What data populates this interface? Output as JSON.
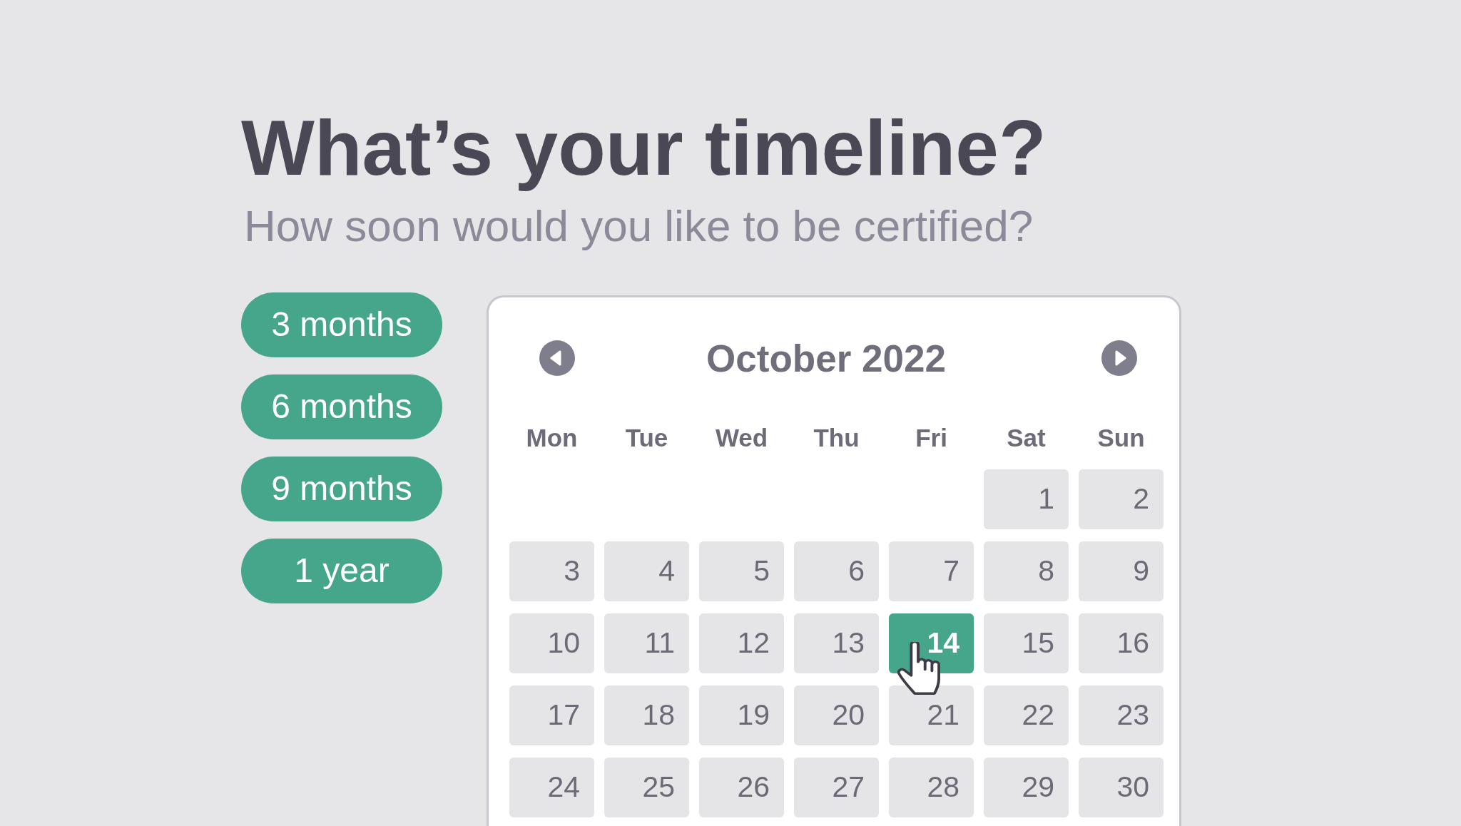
{
  "heading": "What’s your timeline?",
  "subheading": "How soon would you like to be certified?",
  "duration_options": [
    "3 months",
    "6 months",
    "9 months",
    "1 year"
  ],
  "calendar": {
    "title": "October 2022",
    "weekdays": [
      "Mon",
      "Tue",
      "Wed",
      "Thu",
      "Fri",
      "Sat",
      "Sun"
    ],
    "weeks": [
      {
        "days": [
          {
            "label": "1",
            "selected": false
          },
          {
            "label": "2",
            "selected": false
          }
        ]
      },
      {
        "days": [
          {
            "label": "3",
            "selected": false
          },
          {
            "label": "4",
            "selected": false
          },
          {
            "label": "5",
            "selected": false
          },
          {
            "label": "6",
            "selected": false
          },
          {
            "label": "7",
            "selected": false
          },
          {
            "label": "8",
            "selected": false
          },
          {
            "label": "9",
            "selected": false
          }
        ]
      },
      {
        "days": [
          {
            "label": "10",
            "selected": false
          },
          {
            "label": "11",
            "selected": false
          },
          {
            "label": "12",
            "selected": false
          },
          {
            "label": "13",
            "selected": false
          },
          {
            "label": "14",
            "selected": true
          },
          {
            "label": "15",
            "selected": false
          },
          {
            "label": "16",
            "selected": false
          }
        ]
      },
      {
        "days": [
          {
            "label": "17",
            "selected": false
          },
          {
            "label": "18",
            "selected": false
          },
          {
            "label": "19",
            "selected": false
          },
          {
            "label": "20",
            "selected": false
          },
          {
            "label": "21",
            "selected": false
          },
          {
            "label": "22",
            "selected": false
          },
          {
            "label": "23",
            "selected": false
          }
        ]
      },
      {
        "days": [
          {
            "label": "24",
            "selected": false
          },
          {
            "label": "25",
            "selected": false
          },
          {
            "label": "26",
            "selected": false
          },
          {
            "label": "27",
            "selected": false
          },
          {
            "label": "28",
            "selected": false
          },
          {
            "label": "29",
            "selected": false
          },
          {
            "label": "30",
            "selected": false
          }
        ]
      }
    ]
  }
}
